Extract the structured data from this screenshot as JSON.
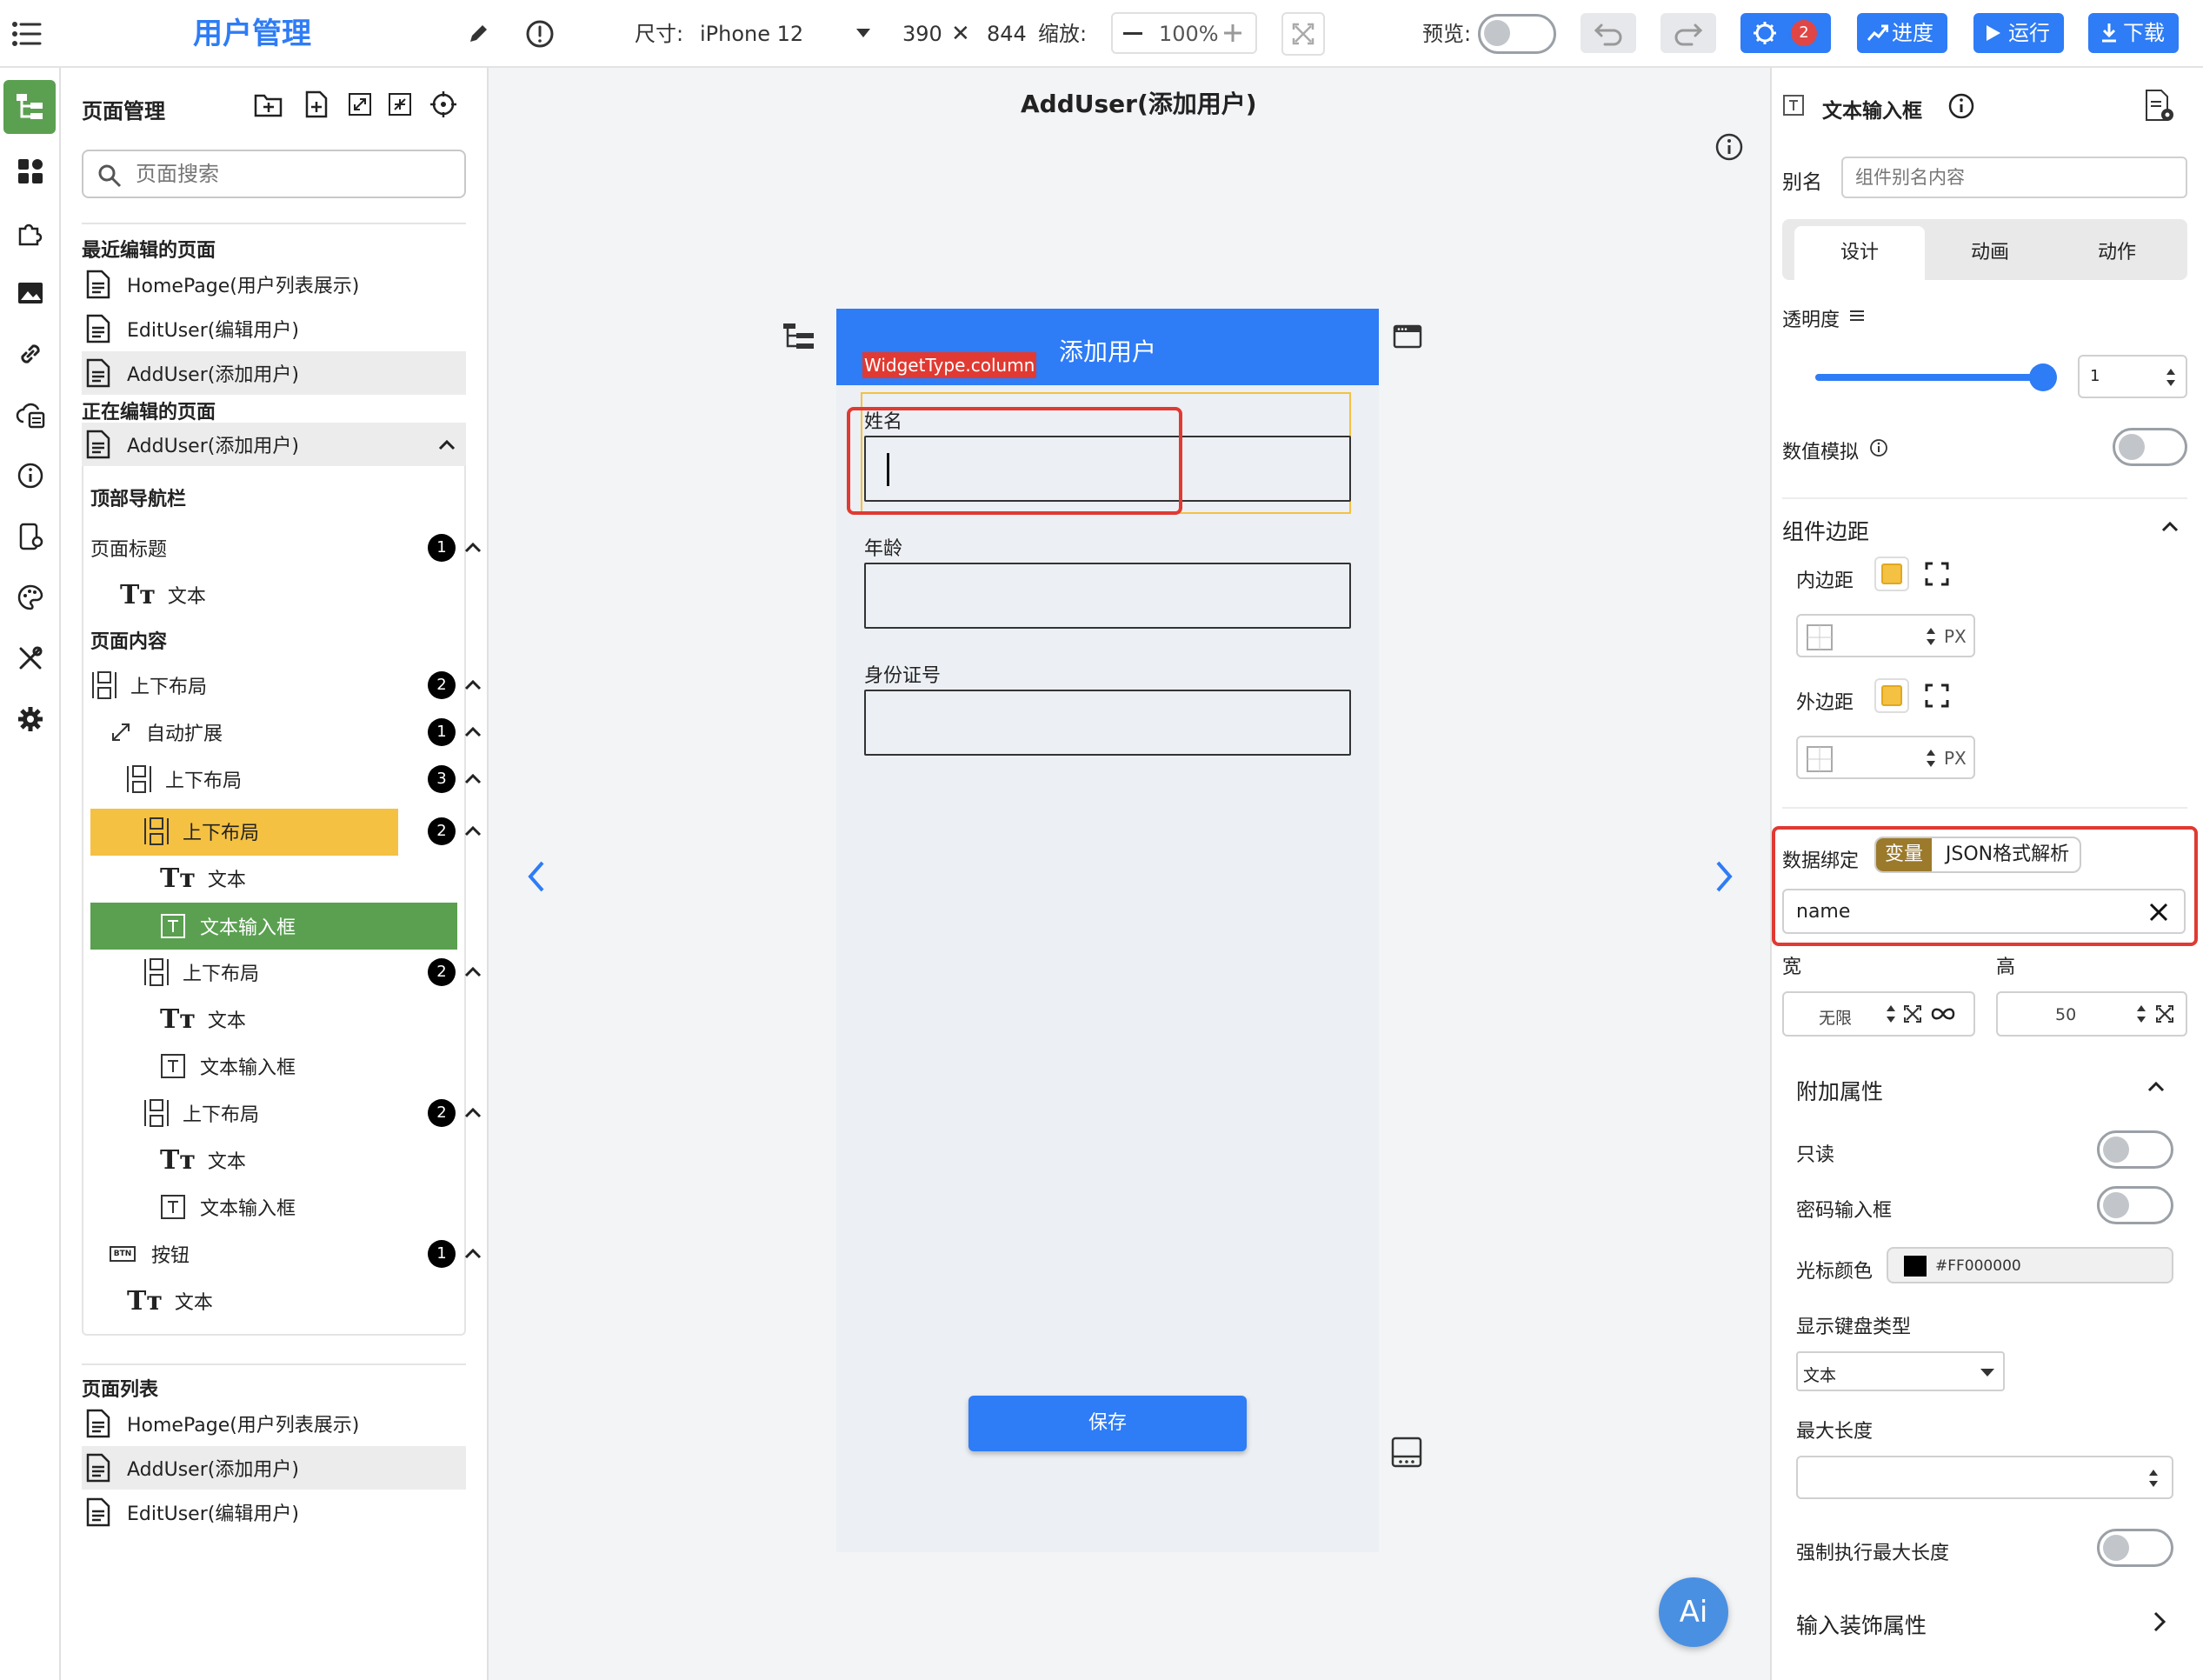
{
  "topbar": {
    "app_title": "用户管理",
    "size_label": "尺寸:",
    "device": "iPhone 12",
    "width": "390",
    "times": "✕",
    "height": "844",
    "zoom_label": "缩放:",
    "zoom_value": "100%",
    "preview_label": "预览:",
    "debug_count": "2",
    "progress_label": "进度",
    "run_label": "运行",
    "download_label": "下载"
  },
  "left_panel": {
    "title": "页面管理",
    "search_placeholder": "页面搜索",
    "recent_heading": "最近编辑的页面",
    "recent_pages": [
      "HomePage(用户列表展示)",
      "EditUser(编辑用户)",
      "AddUser(添加用户)"
    ],
    "editing_heading": "正在编辑的页面",
    "editing_page": "AddUser(添加用户)",
    "tree": {
      "nav_heading": "顶部导航栏",
      "page_title_label": "页面标题",
      "page_title_count": "1",
      "text_label": "文本",
      "content_heading": "页面内容",
      "column_label": "上下布局",
      "column_count": "2",
      "auto_expand_label": "自动扩展",
      "auto_expand_count": "1",
      "inner_column_label": "上下布局",
      "inner_column_count": "3",
      "col1_label": "上下布局",
      "col1_count": "2",
      "col1_text": "文本",
      "col1_input": "文本输入框",
      "col2_label": "上下布局",
      "col2_count": "2",
      "col2_text": "文本",
      "col2_input": "文本输入框",
      "col3_label": "上下布局",
      "col3_count": "2",
      "col3_text": "文本",
      "col3_input": "文本输入框",
      "button_label": "按钮",
      "button_count": "1",
      "button_text": "文本"
    },
    "list_heading": "页面列表",
    "list_pages": [
      "HomePage(用户列表展示)",
      "AddUser(添加用户)",
      "EditUser(编辑用户)"
    ]
  },
  "canvas": {
    "page_heading": "AddUser(添加用户)",
    "widget_type_tag": "WidgetType.column",
    "app_bar_title": "添加用户",
    "field1_label": "姓名",
    "field2_label": "年龄",
    "field3_label": "身份证号",
    "save_button": "保存",
    "ai_button": "Ai"
  },
  "right_panel": {
    "component_name": "文本输入框",
    "alias_label": "别名",
    "alias_placeholder": "组件别名内容",
    "tabs": [
      "设计",
      "动画",
      "动作"
    ],
    "opacity_label": "透明度",
    "opacity_value": "1",
    "opacity": 1,
    "value_mock_label": "数值模拟",
    "spacing_heading": "组件边距",
    "padding_label": "内边距",
    "margin_label": "外边距",
    "unit_px": "PX",
    "binding_label": "数据绑定",
    "binding_variable": "变量",
    "binding_json": "JSON格式解析",
    "binding_value": "name",
    "width_label": "宽",
    "height_label": "高",
    "width_value": "无限",
    "height_value": "50",
    "extra_heading": "附加属性",
    "readonly_label": "只读",
    "password_label": "密码输入框",
    "cursor_color_label": "光标颜色",
    "cursor_color_value": "#FF000000",
    "keyboard_label": "显示键盘类型",
    "keyboard_value": "文本",
    "maxlen_label": "最大长度",
    "force_maxlen_label": "强制执行最大长度",
    "decoration_label": "输入装饰属性"
  },
  "colors": {
    "accent_blue": "#2e7cf6",
    "tree_selected_yellow": "#f5c142",
    "tree_selected_green": "#5aa050",
    "rail_active_green": "#5aa050",
    "highlight_red": "#e03a32",
    "binding_brown": "#9c7a2b"
  }
}
